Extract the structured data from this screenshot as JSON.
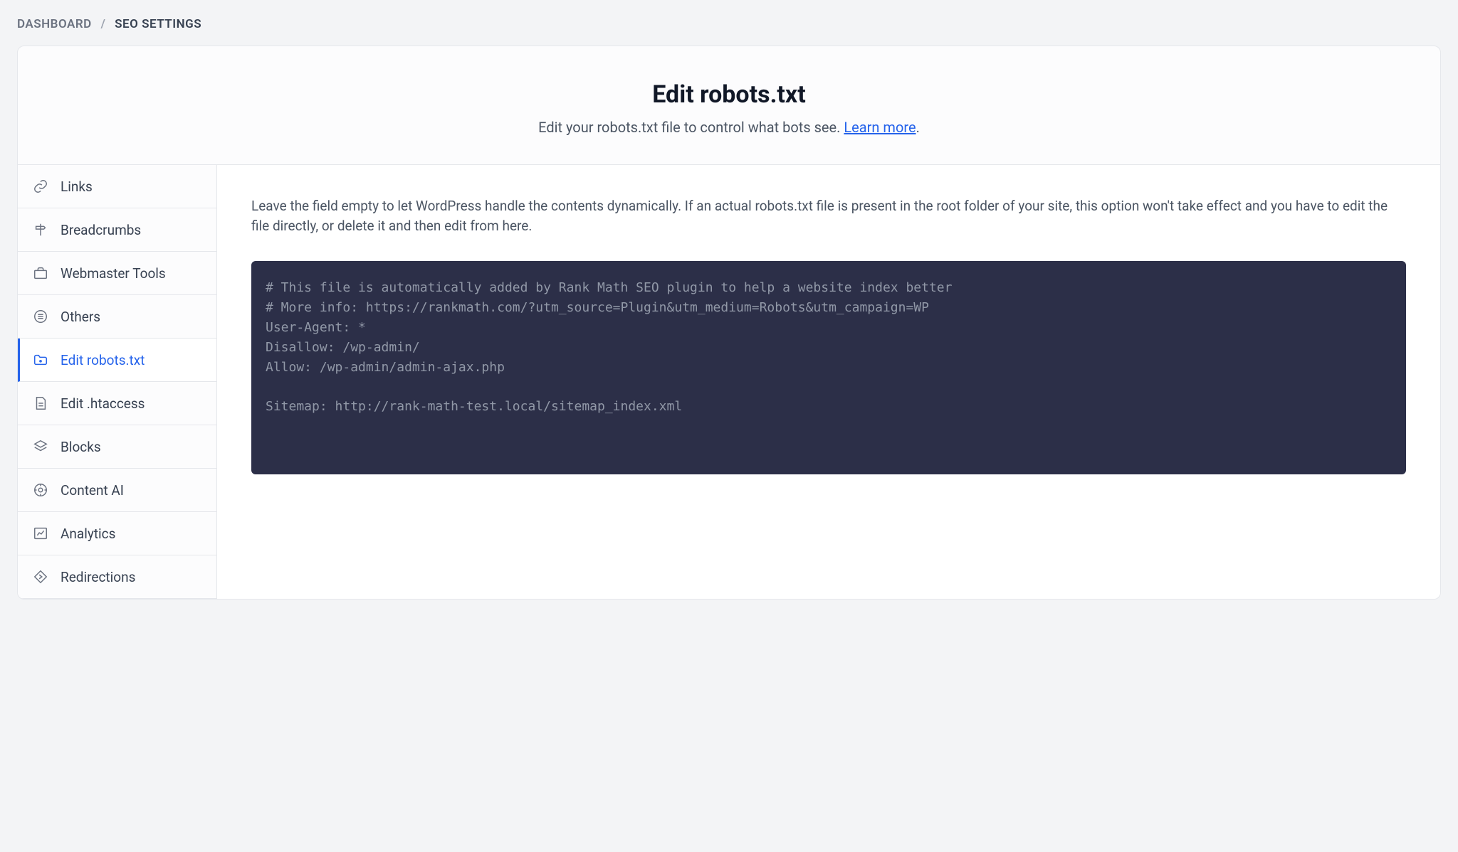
{
  "breadcrumb": {
    "root": "DASHBOARD",
    "sep": "/",
    "current": "SEO SETTINGS"
  },
  "header": {
    "title": "Edit robots.txt",
    "subtitle_before": "Edit your robots.txt file to control what bots see. ",
    "learn_more": "Learn more",
    "subtitle_after": "."
  },
  "sidebar": {
    "items": [
      {
        "label": "Links"
      },
      {
        "label": "Breadcrumbs"
      },
      {
        "label": "Webmaster Tools"
      },
      {
        "label": "Others"
      },
      {
        "label": "Edit robots.txt"
      },
      {
        "label": "Edit .htaccess"
      },
      {
        "label": "Blocks"
      },
      {
        "label": "Content AI"
      },
      {
        "label": "Analytics"
      },
      {
        "label": "Redirections"
      }
    ]
  },
  "main": {
    "helper_text": "Leave the field empty to let WordPress handle the contents dynamically. If an actual robots.txt file is present in the root folder of your site, this option won't take effect and you have to edit the file directly, or delete it and then edit from here.",
    "robots_txt": "# This file is automatically added by Rank Math SEO plugin to help a website index better\n# More info: https://rankmath.com/?utm_source=Plugin&utm_medium=Robots&utm_campaign=WP\nUser-Agent: *\nDisallow: /wp-admin/\nAllow: /wp-admin/admin-ajax.php\n\nSitemap: http://rank-math-test.local/sitemap_index.xml"
  }
}
